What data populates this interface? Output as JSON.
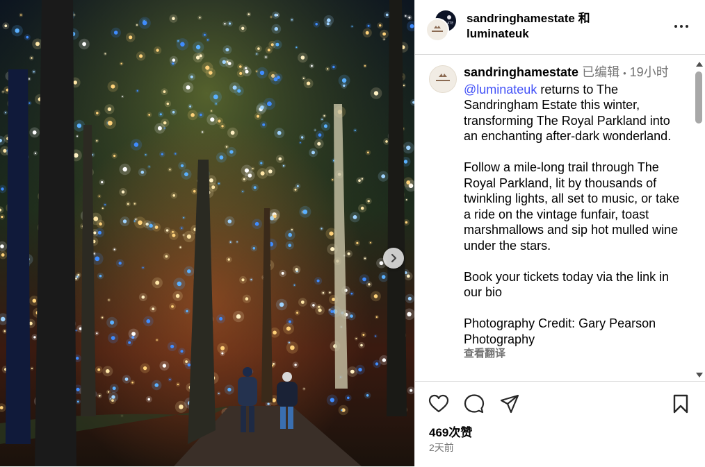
{
  "header": {
    "username": "sandringhamestate",
    "joiner": "和",
    "collaborator": "luminateuk"
  },
  "post": {
    "author": "sandringhamestate",
    "edited": "已编辑",
    "dot": "•",
    "time": "19小时",
    "mention": "@luminateuk",
    "para1": " returns to The Sandringham Estate this winter, transforming The Royal Parkland into an enchanting after-dark wonderland.",
    "para2": "Follow a mile-long trail through The Royal Parkland, lit by thousands of twinkling lights, all set to music, or take a ride on the vintage funfair, toast marshmallows and sip hot mulled wine under the stars.",
    "para3": "Book your tickets today via the link in our bio",
    "para4": "Photography Credit: Gary Pearson Photography",
    "translate": "查看翻译"
  },
  "engagement": {
    "likes": "469次赞",
    "posted": "2天前"
  },
  "icons": {
    "like": "heart-icon",
    "comment": "comment-icon",
    "share": "paper-plane-icon",
    "save": "bookmark-icon",
    "next": "chevron-right-icon",
    "more": "more-horizontal-icon"
  },
  "colors": {
    "mention": "#4150f7",
    "meta": "#737373",
    "divider": "#dbdbdb"
  }
}
